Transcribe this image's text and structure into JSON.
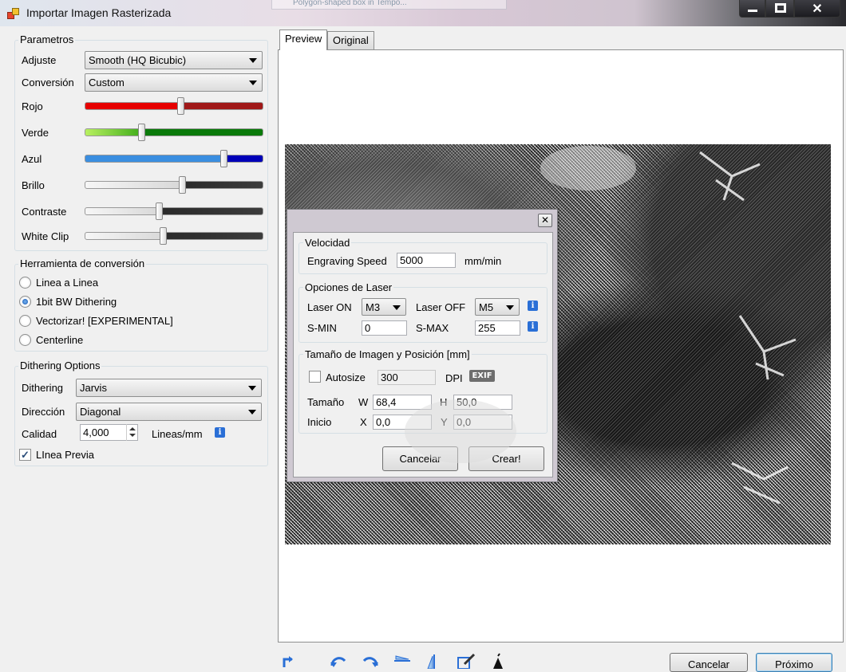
{
  "window": {
    "title": "Importar Imagen Rasterizada",
    "ghost_tab": "Polygon-shaped box in Tempo..."
  },
  "left": {
    "parametros": {
      "title": "Parametros",
      "ajuste_label": "Adjuste",
      "ajuste_value": "Smooth (HQ Bicubic)",
      "conversion_label": "Conversión",
      "conversion_value": "Custom",
      "sliders": [
        {
          "label": "Rojo",
          "value": 0.55
        },
        {
          "label": "Verde",
          "value": 0.32
        },
        {
          "label": "Azul",
          "value": 0.78
        },
        {
          "label": "Brillo",
          "value": 0.55
        },
        {
          "label": "Contraste",
          "value": 0.42
        },
        {
          "label": "White Clip",
          "value": 0.45
        }
      ]
    },
    "herramienta": {
      "title": "Herramienta de conversión",
      "options": [
        "Linea a Linea",
        "1bit BW Dithering",
        "Vectorizar! [EXPERIMENTAL]",
        "Centerline"
      ],
      "selected": "1bit BW Dithering"
    },
    "dithering": {
      "title": "Dithering Options",
      "dithering_label": "Dithering",
      "dithering_value": "Jarvis",
      "direccion_label": "Dirección",
      "direccion_value": "Diagonal",
      "calidad_label": "Calidad",
      "calidad_value": "4,000",
      "calidad_unit": "Lineas/mm",
      "linea_previa_label": "LInea Previa",
      "linea_previa_checked": true
    }
  },
  "tabs": [
    {
      "label": "Preview",
      "active": true
    },
    {
      "label": "Original",
      "active": false
    }
  ],
  "bottom": {
    "cancel_label": "Cancelar",
    "next_label": "Próximo"
  },
  "dialog": {
    "velocidad": {
      "title": "Velocidad",
      "speed_label": "Engraving Speed",
      "speed_value": "5000",
      "speed_unit": "mm/min"
    },
    "laser": {
      "title": "Opciones de Laser",
      "on_label": "Laser ON",
      "on_value": "M3",
      "off_label": "Laser OFF",
      "off_value": "M5",
      "smin_label": "S-MIN",
      "smin_value": "0",
      "smax_label": "S-MAX",
      "smax_value": "255"
    },
    "tamano": {
      "title": "Tamaño de Imagen y Posición [mm]",
      "autosize_label": "Autosize",
      "autosize_checked": false,
      "dpi_value": "300",
      "dpi_label": "DPI",
      "exif_label": "EXIF",
      "size_label": "Tamaño",
      "w_label": "W",
      "w_value": "68,4",
      "h_label": "H",
      "h_value": "50,0",
      "start_label": "Inicio",
      "x_label": "X",
      "x_value": "0,0",
      "y_label": "Y",
      "y_value": "0,0"
    },
    "cancel_label": "Cancelar",
    "create_label": "Crear!",
    "close_glyph": "✕"
  },
  "colors": {
    "red_track": "#e00000",
    "green_track": "#1a9e1a",
    "blue_track": "#2b7fd6",
    "dark_track": "#2a2a2a",
    "info_blue": "#2a6fd6"
  },
  "icons": [
    "restore-icon",
    "rotate-left-icon",
    "rotate-right-icon",
    "flip-horizontal-icon",
    "flip-vertical-icon",
    "edit-icon",
    "invert-icon"
  ]
}
